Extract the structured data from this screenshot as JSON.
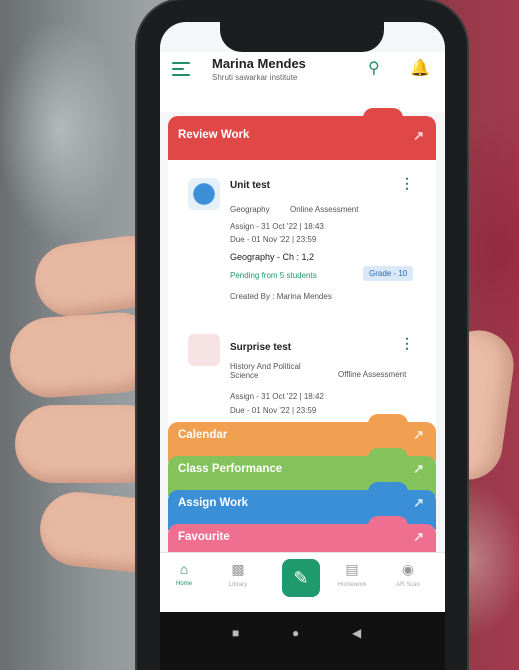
{
  "header": {
    "user_name": "Marina Mendes",
    "institute": "Shruti sawarkar institute"
  },
  "review": {
    "label": "Review Work",
    "color": "#e04848"
  },
  "cards": [
    {
      "title": "Unit test",
      "subject": "Geography",
      "type": "Online Assessment",
      "assign": "Assign - 31 Oct '22 | 18:43",
      "due": "Due - 01 Nov '22 | 23:59",
      "chapter": "Geography - Ch : 1,2",
      "pending": "Pending from 5 students",
      "grade": "Grade - 10",
      "created": "Created By : Marina Mendes"
    },
    {
      "title": "Surprise test",
      "subject": "History And Political Science",
      "type": "Offline Assessment",
      "assign": "Assign - 31 Oct '22 | 18:42",
      "due": "Due - 01 Nov '22 | 23:59"
    }
  ],
  "bands": [
    {
      "label": "Calendar",
      "color": "#f0a050"
    },
    {
      "label": "Class Performance",
      "color": "#84c25c"
    },
    {
      "label": "Assign Work",
      "color": "#3b8fd6"
    },
    {
      "label": "Favourite",
      "color": "#ef6f90"
    }
  ],
  "nav": {
    "home": "Home",
    "library": "Library",
    "homework": "Homework",
    "scan": "AR Scan"
  },
  "icons": {
    "menu": "hamburger-icon",
    "search": "search-icon",
    "bell": "bell-icon",
    "arrow": "arrow-up-right-icon",
    "edit": "pencil-icon"
  },
  "accent": "#1f8f6a"
}
